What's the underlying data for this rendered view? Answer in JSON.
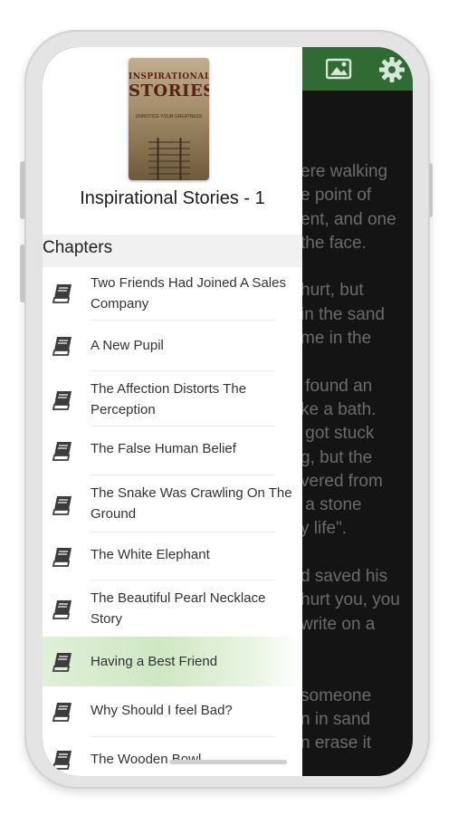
{
  "colors": {
    "accent": "#2f6b32",
    "active_highlight": "#cfe7c3",
    "reader_background": "#141414"
  },
  "app_bar": {
    "icons": [
      "image-icon",
      "gear-icon"
    ]
  },
  "reader": {
    "visible_text": "ere walking\ne point of\nent, and one\nthe face.\n\nhurt, but\nin the sand\nme in the\n\n found an\nke a bath.\n got stuck\ng, but the\nvered from\n a stone\ny life\".\n\nd saved his\nhurt you, you\nwrite on a\n\n\nsomeone\nn in sand\nn erase it"
  },
  "drawer": {
    "cover": {
      "title_line1": "INSPIRATIONAL",
      "title_line2": "STORIES",
      "subtitle": "UNNOTICE YOUR GREATNESS"
    },
    "book_title": "Inspirational Stories - 1",
    "chapters_header": "Chapters",
    "chapters": [
      {
        "label": "Two Friends Had Joined A Sales Company",
        "icon": "book-icon",
        "active": false
      },
      {
        "label": "A New Pupil",
        "icon": "book-icon",
        "active": false
      },
      {
        "label": "The Affection Distorts The Perception",
        "icon": "book-icon",
        "active": false
      },
      {
        "label": "The False Human Belief",
        "icon": "book-icon",
        "active": false
      },
      {
        "label": "The Snake Was Crawling On The Ground",
        "icon": "book-icon",
        "active": false
      },
      {
        "label": "The White Elephant",
        "icon": "book-icon",
        "active": false
      },
      {
        "label": "The Beautiful Pearl Necklace Story",
        "icon": "book-icon",
        "active": false
      },
      {
        "label": "Having a Best Friend",
        "icon": "book-icon",
        "active": true
      },
      {
        "label": "Why Should I feel Bad?",
        "icon": "book-icon",
        "active": false
      },
      {
        "label": "The Wooden Bowl",
        "icon": "book-icon",
        "active": false
      }
    ]
  }
}
